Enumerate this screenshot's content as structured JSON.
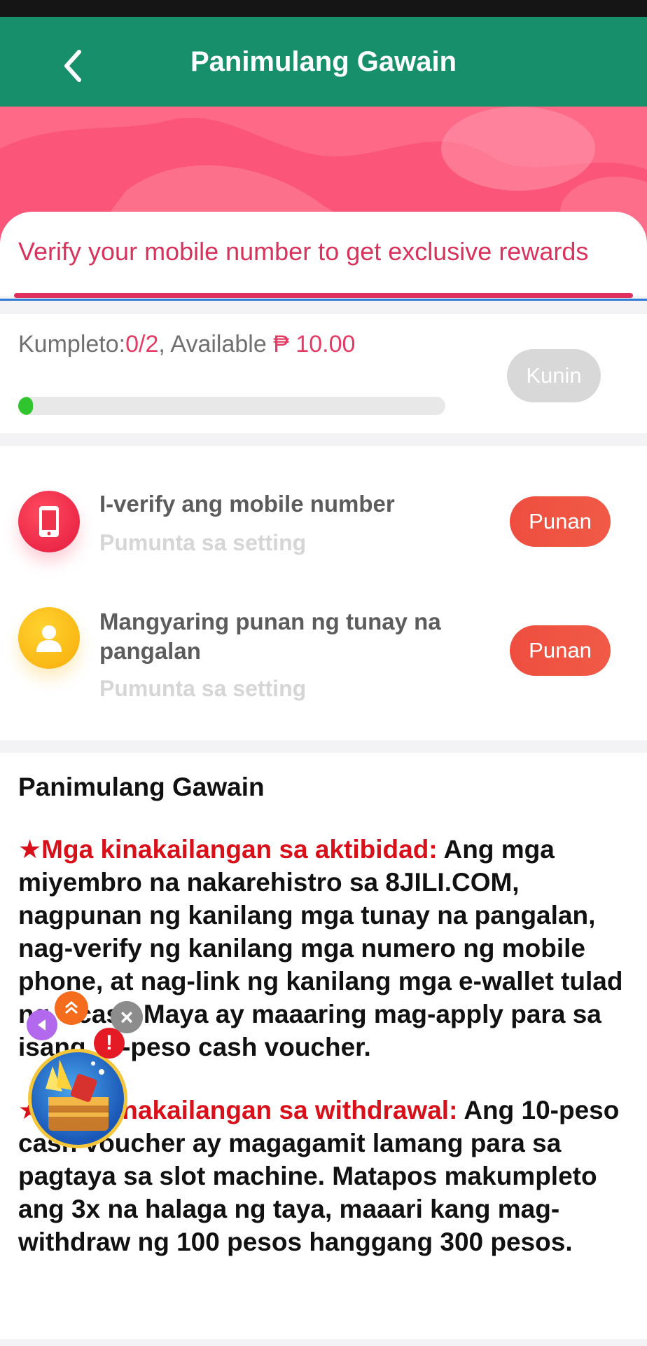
{
  "header": {
    "title": "Panimulang Gawain"
  },
  "banner": {
    "text": "Verify your mobile number to get exclusive rewards"
  },
  "progress": {
    "completed_label": "Kumpleto:",
    "completed_value": "0/2",
    "available_label": ", Available ",
    "available_amount": "₱ 10.00",
    "fill_fraction": 0.035,
    "claim_label": "Kunin"
  },
  "tasks": [
    {
      "title": "I-verify ang mobile number",
      "subtitle": "Pumunta sa setting",
      "action": "Punan",
      "icon": "phone-icon"
    },
    {
      "title": "Mangyaring punan ng tunay na pangalan",
      "subtitle": "Pumunta sa setting",
      "action": "Punan",
      "icon": "user-icon"
    }
  ],
  "rules": {
    "heading": "Panimulang Gawain",
    "p1_label": "★Mga kinakailangan sa aktibidad:",
    "p1_text": " Ang mga miyembro na nakarehistro sa 8JILI.COM, nagpunan ng kanilang mga tunay na pangalan, nag-verify ng kanilang mga numero ng mobile phone, at nag-link ng kanilang mga e-wallet tulad ng Gcash Maya ay maaaring mag-apply para sa isang 10-peso cash voucher.",
    "p2_label": "★Mga kinakailangan sa withdrawal:",
    "p2_text": " Ang 10-peso cash voucher ay magagamit lamang para sa pagtaya sa slot machine. Matapos makumpleto ang 3x na halaga ng taya, maaari kang mag-withdraw ng 100 pesos hanggang 300 pesos."
  },
  "floating_widget": {
    "badge": "!",
    "close": "×"
  },
  "colors": {
    "header": "#168f6a",
    "accent": "#e43a63",
    "button": "#ef4e3f",
    "progress": "#30c52f"
  }
}
